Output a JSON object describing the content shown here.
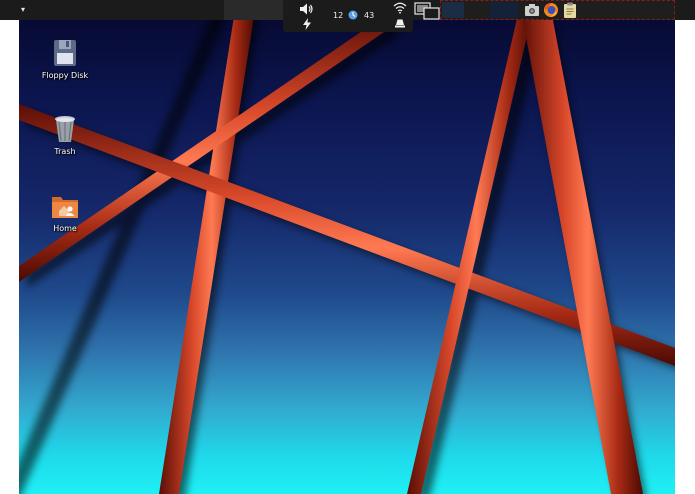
{
  "desktop": {
    "icons": [
      {
        "label": "Floppy Disk",
        "icon": "floppy-disk-icon"
      },
      {
        "label": "Trash",
        "icon": "trash-icon"
      },
      {
        "label": "Home",
        "icon": "home-folder-icon"
      }
    ]
  },
  "panel": {
    "menu_icon": "menu-arrow-icon",
    "status": {
      "hours": "12",
      "minutes": "43",
      "icons": [
        "volume-icon",
        "power-icon",
        "clock-icon",
        "wifi-icon",
        "eject-icon"
      ]
    },
    "tray": {
      "icons": [
        "screens-icon",
        "screenshot-icon",
        "firefox-icon",
        "clipboard-icon"
      ]
    }
  },
  "colors": {
    "panel": "#1b1b1b",
    "wallpaper_top": "#070a33",
    "wallpaper_bottom": "#1ff0f4",
    "beams": "#c4391c"
  }
}
